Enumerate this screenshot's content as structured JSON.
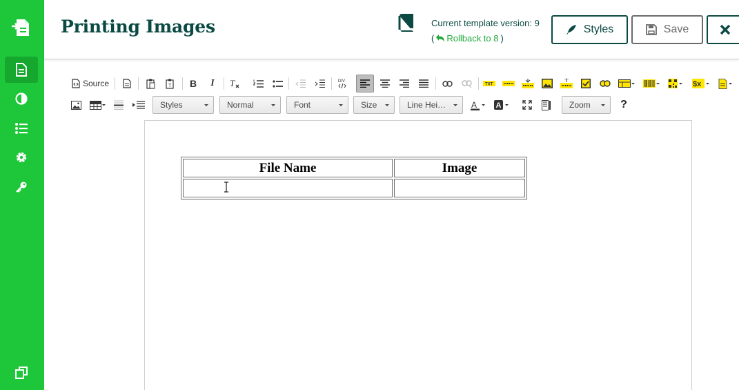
{
  "sidebar": {
    "items": [
      {
        "name": "document-icon",
        "active": true
      },
      {
        "name": "contrast-icon",
        "active": false
      },
      {
        "name": "list-icon",
        "active": false
      },
      {
        "name": "gear-icon",
        "active": false
      },
      {
        "name": "key-icon",
        "active": false
      }
    ]
  },
  "header": {
    "title": "Printing Images",
    "version_text": "Current template version: 9",
    "rollback_label": "Rollback to 8",
    "paren_open": "(",
    "paren_close": ")",
    "styles_label": "Styles",
    "save_label": "Save"
  },
  "toolbar": {
    "source_label": "Source",
    "combos": {
      "styles": "Styles",
      "format": "Normal",
      "font": "Font",
      "size": "Size",
      "line_height": "Line Hei…",
      "zoom": "Zoom"
    },
    "help": "?"
  },
  "document": {
    "table": {
      "headers": [
        "File Name",
        "Image"
      ],
      "rows": [
        [
          "",
          ""
        ]
      ]
    }
  },
  "colors": {
    "sidebar_green": "#1ec739",
    "brand_dark": "#0b4a43",
    "link_green": "#1fa83a",
    "plugin_yellow": "#ffe600"
  }
}
